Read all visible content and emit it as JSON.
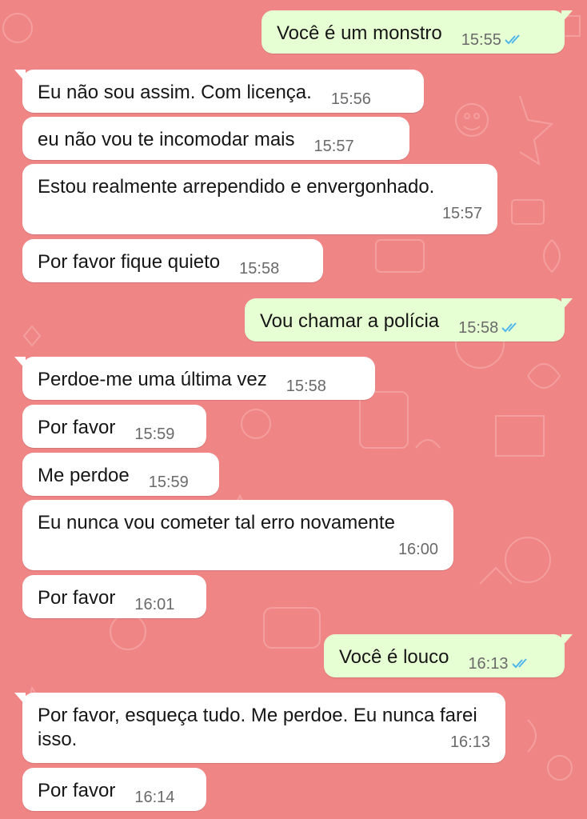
{
  "colors": {
    "background": "#f08585",
    "incoming_bubble": "#ffffff",
    "outgoing_bubble": "#e6ffd3",
    "read_ticks": "#4fb6ec"
  },
  "messages": [
    {
      "direction": "outgoing",
      "text": "Você é um monstro",
      "time": "15:55",
      "status_icon": "double-check-read-icon"
    },
    {
      "direction": "incoming",
      "text": "Eu não sou assim. Com licença.",
      "time": "15:56"
    },
    {
      "direction": "incoming",
      "text": "eu não vou te incomodar mais",
      "time": "15:57"
    },
    {
      "direction": "incoming",
      "text": "Estou realmente arrependido e envergonhado.",
      "time": "15:57"
    },
    {
      "direction": "incoming",
      "text": "Por favor fique quieto",
      "time": "15:58"
    },
    {
      "direction": "outgoing",
      "text": "Vou chamar a polícia",
      "time": "15:58",
      "status_icon": "double-check-read-icon"
    },
    {
      "direction": "incoming",
      "text": "Perdoe-me uma última vez",
      "time": "15:58"
    },
    {
      "direction": "incoming",
      "text": "Por favor",
      "time": "15:59"
    },
    {
      "direction": "incoming",
      "text": "Me perdoe",
      "time": "15:59"
    },
    {
      "direction": "incoming",
      "text": "Eu nunca vou cometer tal erro novamente",
      "time": "16:00"
    },
    {
      "direction": "incoming",
      "text": "Por favor",
      "time": "16:01"
    },
    {
      "direction": "outgoing",
      "text": "Você é louco",
      "time": "16:13",
      "status_icon": "double-check-read-icon"
    },
    {
      "direction": "incoming",
      "text": "Por favor, esqueça tudo. Me perdoe. Eu nunca farei isso.",
      "time": "16:13"
    },
    {
      "direction": "incoming",
      "text": "Por favor",
      "time": "16:14"
    }
  ]
}
